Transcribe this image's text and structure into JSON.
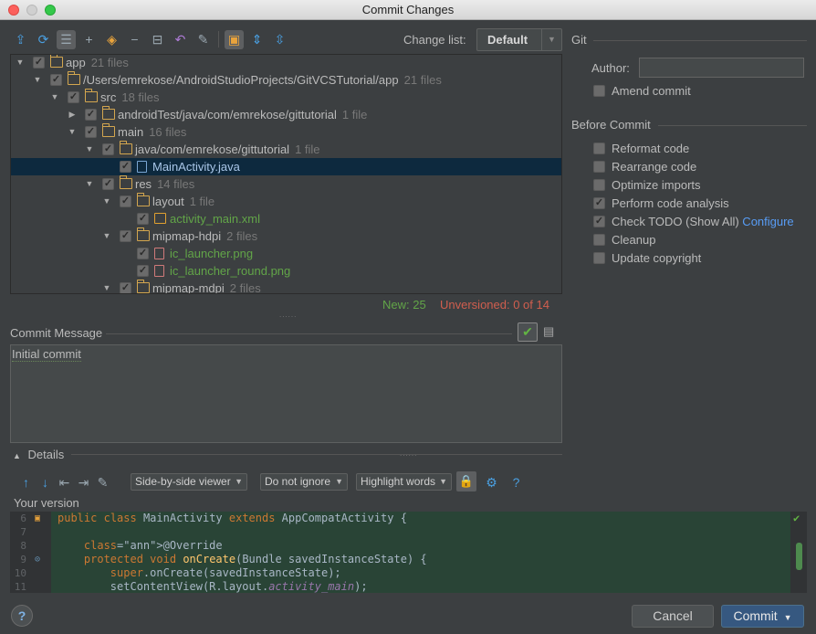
{
  "window": {
    "title": "Commit Changes"
  },
  "toolbar": {
    "changelist_label": "Change list:",
    "changelist_value": "Default"
  },
  "tree": [
    {
      "label": "app",
      "count": "21 files",
      "type": "folder",
      "color": "normal",
      "level": 0,
      "expanded": true
    },
    {
      "label": "/Users/emrekose/AndroidStudioProjects/GitVCSTutorial/app",
      "count": "21 files",
      "type": "folder",
      "color": "normal",
      "level": 1,
      "expanded": true
    },
    {
      "label": "src",
      "count": "18 files",
      "type": "folder",
      "color": "normal",
      "level": 2,
      "expanded": true
    },
    {
      "label": "androidTest/java/com/emrekose/gittutorial",
      "count": "1 file",
      "type": "folder",
      "color": "normal",
      "level": 3,
      "expanded": false
    },
    {
      "label": "main",
      "count": "16 files",
      "type": "folder",
      "color": "normal",
      "level": 3,
      "expanded": true
    },
    {
      "label": "java/com/emrekose/gittutorial",
      "count": "1 file",
      "type": "folder",
      "color": "normal",
      "level": 4,
      "expanded": true
    },
    {
      "label": "MainActivity.java",
      "count": "",
      "type": "java",
      "color": "blue",
      "level": 5,
      "selected": true
    },
    {
      "label": "res",
      "count": "14 files",
      "type": "folder",
      "color": "normal",
      "level": 4,
      "expanded": true
    },
    {
      "label": "layout",
      "count": "1 file",
      "type": "folder",
      "color": "normal",
      "level": 5,
      "expanded": true
    },
    {
      "label": "activity_main.xml",
      "count": "",
      "type": "xml",
      "color": "green",
      "level": 6
    },
    {
      "label": "mipmap-hdpi",
      "count": "2 files",
      "type": "folder",
      "color": "normal",
      "level": 5,
      "expanded": true
    },
    {
      "label": "ic_launcher.png",
      "count": "",
      "type": "png",
      "color": "green",
      "level": 6
    },
    {
      "label": "ic_launcher_round.png",
      "count": "",
      "type": "png",
      "color": "green",
      "level": 6
    },
    {
      "label": "mipmap-mdpi",
      "count": "2 files",
      "type": "folder",
      "color": "normal",
      "level": 5,
      "expanded": true
    }
  ],
  "stats": {
    "new": "New: 25",
    "unversioned": "Unversioned: 0 of 14"
  },
  "commit_message": {
    "label": "Commit Message",
    "value": "Initial commit"
  },
  "details": {
    "label": "Details",
    "viewer": "Side-by-side viewer",
    "ignore": "Do not ignore",
    "highlight": "Highlight words",
    "your_version": "Your version"
  },
  "code_lines": [
    {
      "num": "6",
      "text": "public class MainActivity extends AppCompatActivity {"
    },
    {
      "num": "7",
      "text": ""
    },
    {
      "num": "8",
      "text": "    @Override"
    },
    {
      "num": "9",
      "text": "    protected void onCreate(Bundle savedInstanceState) {"
    },
    {
      "num": "10",
      "text": "        super.onCreate(savedInstanceState);"
    },
    {
      "num": "11",
      "text": "        setContentView(R.layout.activity_main);"
    }
  ],
  "git": {
    "title": "Git",
    "author_label": "Author:",
    "author_value": "",
    "amend": "Amend commit"
  },
  "before_commit": {
    "title": "Before Commit",
    "options": [
      {
        "label": "Reformat code",
        "checked": false
      },
      {
        "label": "Rearrange code",
        "checked": false
      },
      {
        "label": "Optimize imports",
        "checked": false
      },
      {
        "label": "Perform code analysis",
        "checked": true
      },
      {
        "label": "Check TODO (Show All)",
        "checked": true,
        "link": "Configure"
      },
      {
        "label": "Cleanup",
        "checked": false
      },
      {
        "label": "Update copyright",
        "checked": false
      }
    ]
  },
  "buttons": {
    "cancel": "Cancel",
    "commit": "Commit",
    "help": "?"
  }
}
